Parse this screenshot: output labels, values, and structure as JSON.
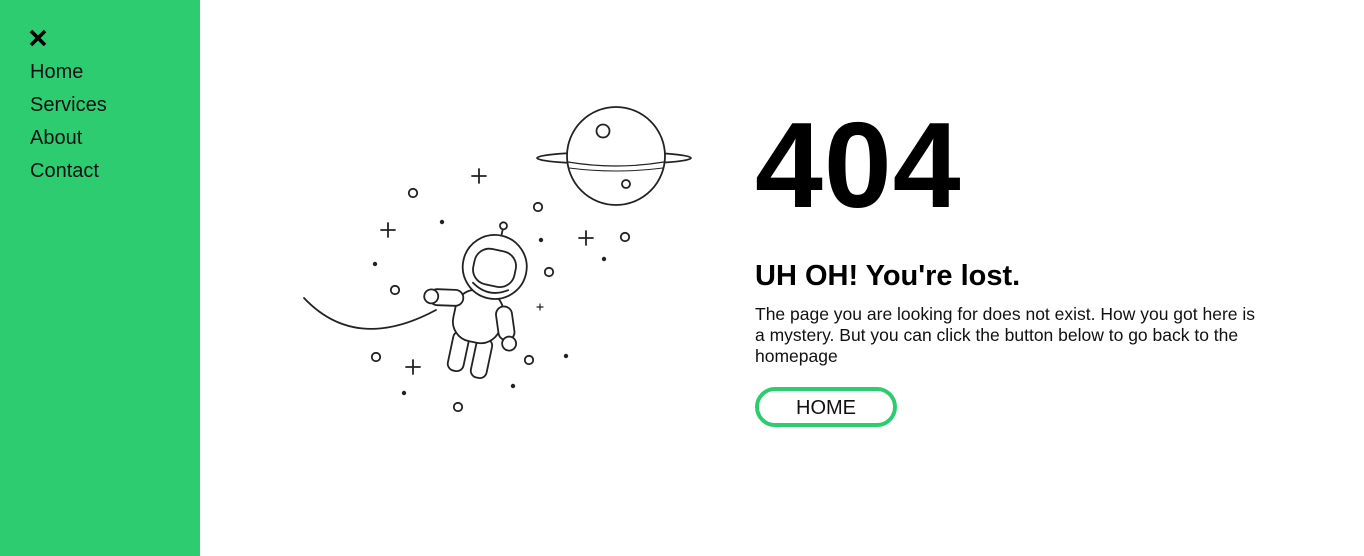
{
  "colors": {
    "accent": "#2ecc71",
    "text": "#111111",
    "background": "#ffffff"
  },
  "sidebar": {
    "close_icon": "close-icon",
    "items": [
      {
        "label": "Home"
      },
      {
        "label": "Services"
      },
      {
        "label": "About"
      },
      {
        "label": "Contact"
      }
    ]
  },
  "illustration": {
    "icon": "astronaut-floating-in-space-illustration"
  },
  "main": {
    "error_code": "404",
    "headline": "UH OH! You're lost.",
    "message": "The page you are looking for does not exist. How you got here is a mystery. But you can click the button below to go back to the homepage",
    "home_button_label": "HOME"
  }
}
